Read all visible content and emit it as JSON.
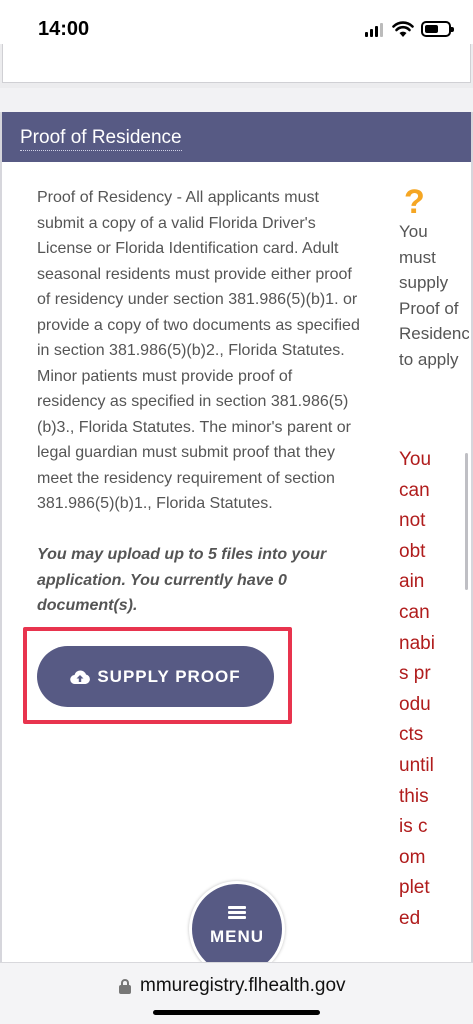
{
  "status_bar": {
    "time": "14:00"
  },
  "section": {
    "title": "Proof of Residence",
    "header_color": "#575a84",
    "body": "Proof of Residency - All applicants must submit a copy of a valid Florida Driver's License or Florida Identification card. Adult seasonal residents must provide either proof of residency under section 381.986(5)(b)1. or provide a copy of two documents as specified in section 381.986(5)(b)2., Florida Statutes. Minor patients must provide proof of residency as specified in section 381.986(5)(b)3., Florida Statutes. The minor's parent or legal guardian must submit proof that they meet the residency requirement of section 381.986(5)(b)1., Florida Statutes.",
    "upload_note": "You may upload up to 5 files into your application. You currently have 0 document(s).",
    "supply_button_label": "SUPPLY PROOF",
    "help_icon": "?",
    "hint": "You must supply Proof of Residence to apply",
    "warning": "You can not obtain cannabis products until this is completed"
  },
  "menu": {
    "label": "MENU"
  },
  "browser": {
    "url": "mmuregistry.flhealth.gov"
  },
  "colors": {
    "accent": "#575a84",
    "warning": "#b01c1c",
    "help": "#f5a623",
    "highlight": "#e8344e"
  }
}
